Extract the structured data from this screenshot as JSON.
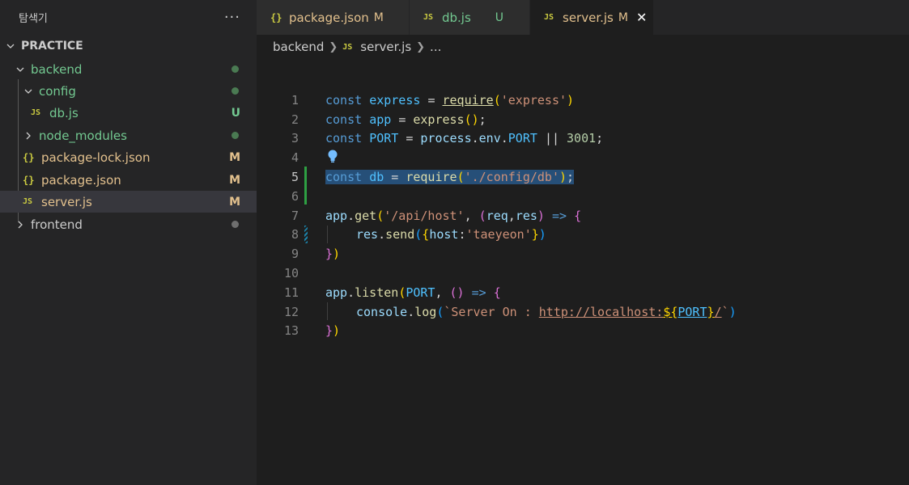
{
  "sidebar": {
    "title": "탐색기",
    "more": "···",
    "project": "PRACTICE",
    "items": [
      {
        "label": "backend",
        "status": ""
      },
      {
        "label": "config",
        "status": ""
      },
      {
        "label": "db.js",
        "status": "U"
      },
      {
        "label": "node_modules",
        "status": ""
      },
      {
        "label": "package-lock.json",
        "status": "M"
      },
      {
        "label": "package.json",
        "status": "M"
      },
      {
        "label": "server.js",
        "status": "M"
      },
      {
        "label": "frontend",
        "status": ""
      }
    ]
  },
  "tabs": [
    {
      "label": "package.json",
      "status": "M",
      "icon": "{}"
    },
    {
      "label": "db.js",
      "status": "U",
      "icon": "JS"
    },
    {
      "label": "server.js",
      "status": "M",
      "icon": "JS",
      "close": "✕"
    }
  ],
  "breadcrumb": {
    "folder": "backend",
    "icon": "JS",
    "file": "server.js",
    "more": "..."
  },
  "icons": {
    "js": "JS",
    "json": "{}"
  },
  "colors": {
    "modified": "#e2c08d",
    "untracked": "#73c991",
    "folder_text": "#73c991",
    "selection": "#264f78",
    "js_icon": "#cbcb41"
  },
  "editor": {
    "line_numbers": [
      "1",
      "2",
      "3",
      "4",
      "5",
      "6",
      "7",
      "8",
      "9",
      "10",
      "11",
      "12",
      "13"
    ],
    "l1": {
      "kw": "const",
      "name": "express",
      "eq": "=",
      "fn": "require",
      "open": "(",
      "str": "'express'",
      "close": ")"
    },
    "l2": {
      "kw": "const",
      "name": "app",
      "eq": "=",
      "fn": "express",
      "parens": "()",
      "semi": ";"
    },
    "l3": {
      "kw": "const",
      "name": "PORT",
      "eq": "=",
      "obj": "process",
      "dot1": ".",
      "env": "env",
      "dot2": ".",
      "port": "PORT",
      "or": "||",
      "num": "3001",
      "semi": ";"
    },
    "l5": {
      "kw": "const",
      "name": "db",
      "eq": "=",
      "fn": "require",
      "open": "(",
      "str": "'./config/db'",
      "close": ")",
      "semi": ";"
    },
    "l7": {
      "obj": "app",
      "dot": ".",
      "fn": "get",
      "open": "(",
      "str": "'/api/host'",
      "comma": ",",
      "popen": "(",
      "p1": "req",
      "pc": ",",
      "p2": "res",
      "pclose": ")",
      "arrow": "=>",
      "brace": "{"
    },
    "l8": {
      "obj": "res",
      "dot": ".",
      "fn": "send",
      "open": "(",
      "bopen": "{",
      "key": "host",
      "colon": ":",
      "str": "'taeyeon'",
      "bclose": "}",
      "close": ")"
    },
    "l9": {
      "brace": "}",
      "close": ")"
    },
    "l11": {
      "obj": "app",
      "dot": ".",
      "fn": "listen",
      "open": "(",
      "arg": "PORT",
      "comma": ",",
      "parens": "()",
      "arrow": "=>",
      "brace": "{"
    },
    "l12": {
      "obj": "console",
      "dot": ".",
      "fn": "log",
      "open": "(",
      "tick": "`",
      "str1": "Server On : ",
      "url": "http://localhost:",
      "dollar": "${",
      "var": "PORT",
      "end": "}",
      "slash": "/",
      "tick2": "`",
      "close": ")"
    },
    "l13": {
      "brace": "}",
      "close": ")"
    }
  }
}
